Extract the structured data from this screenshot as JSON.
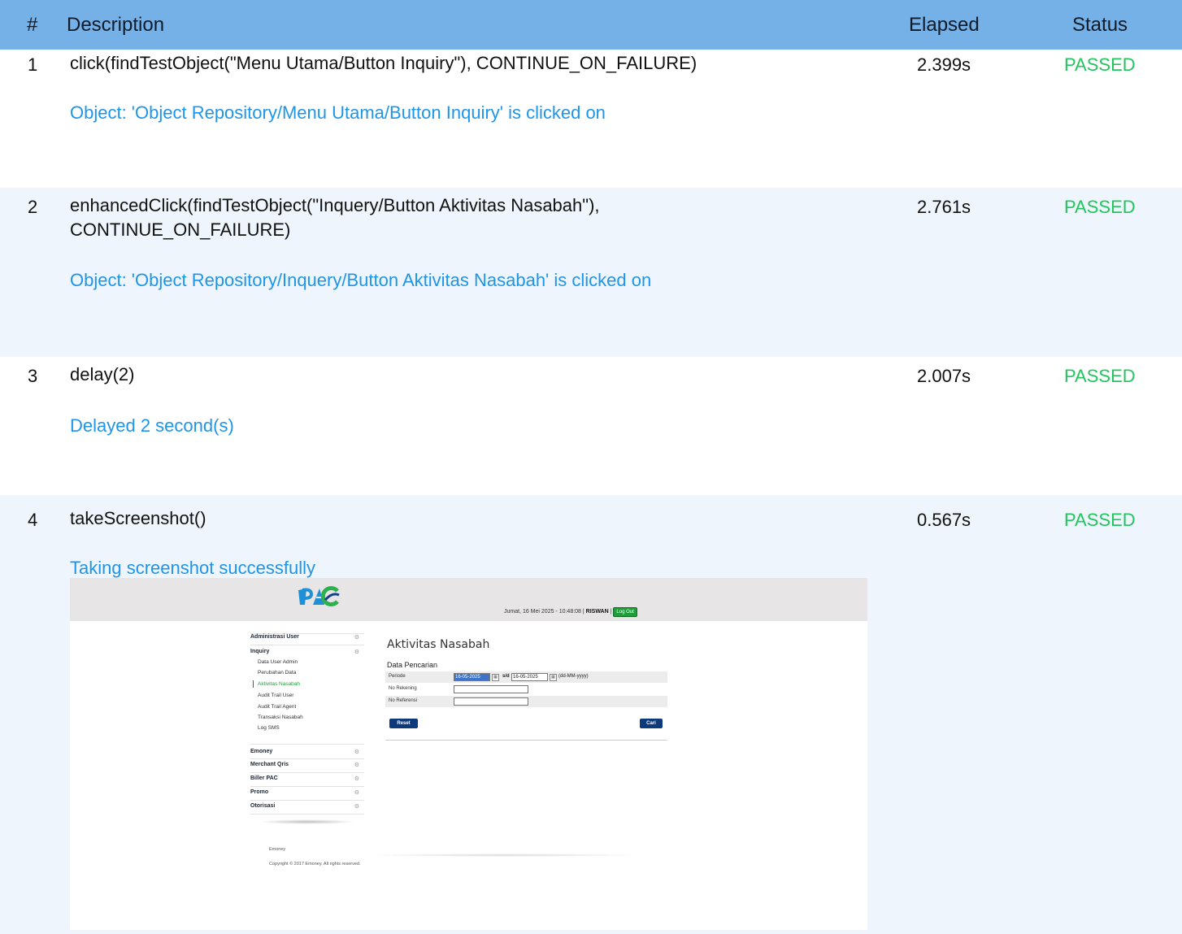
{
  "header": {
    "num": "#",
    "description": "Description",
    "elapsed": "Elapsed",
    "status": "Status"
  },
  "rows": [
    {
      "num": "1",
      "description": "click(findTestObject(\"Menu Utama/Button Inquiry\"), CONTINUE_ON_FAILURE)",
      "elapsed": "2.399s",
      "status": "PASSED",
      "log": "Object: 'Object Repository/Menu Utama/Button Inquiry' is clicked on"
    },
    {
      "num": "2",
      "description_line1": "enhancedClick(findTestObject(\"Inquery/Button Aktivitas Nasabah\"),",
      "description_line2": "CONTINUE_ON_FAILURE)",
      "elapsed": "2.761s",
      "status": "PASSED",
      "log": "Object: 'Object Repository/Inquery/Button Aktivitas Nasabah' is clicked on"
    },
    {
      "num": "3",
      "description": "delay(2)",
      "elapsed": "2.007s",
      "status": "PASSED",
      "log": "Delayed 2 second(s)"
    },
    {
      "num": "4",
      "description": "takeScreenshot()",
      "elapsed": "0.567s",
      "status": "PASSED",
      "log": "Taking screenshot successfully"
    }
  ],
  "colors": {
    "header_bg": "#75b0e6",
    "alt_row_bg": "#eef5fc",
    "passed": "#22c55e",
    "log_text": "#1f95e8"
  },
  "screenshot": {
    "logo": "PAC",
    "top_info": {
      "datetime": "Jumat, 16 Mei 2025 - 10:48:08 |",
      "user": "RISWAN",
      "separator": "|",
      "logout": "Log Out"
    },
    "sidebar": {
      "sections": [
        "Administrasi User",
        "Inquiry",
        "Emoney",
        "Merchant Qris",
        "Biller PAC",
        "Promo",
        "Otorisasi"
      ],
      "inquiry_items": [
        "Data User Admin",
        "Perubahan Data",
        "Aktivitas Nasabah",
        "Audit Trail User",
        "Audit Trail Agent",
        "Transaksi Nasabah",
        "Log SMS"
      ],
      "active_item": "Aktivitas Nasabah",
      "gear_icon": "gear-icon"
    },
    "main": {
      "title": "Aktivitas Nasabah",
      "form_title": "Data Pencarian",
      "periode_label": "Periode",
      "date_from": "16-05-2025",
      "sd_label": "s/d",
      "date_to": "16-05-2025",
      "date_format": "(dd-MM-yyyy)",
      "rekening_label": "No Rekening",
      "rekening_value": "",
      "referensi_label": "No Referensi",
      "referensi_value": "",
      "reset_label": "Reset",
      "cari_label": "Cari"
    },
    "footer": {
      "brand": "Emoney",
      "copyright": "Copyright © 2017 Emoney. All rights reserved."
    }
  }
}
